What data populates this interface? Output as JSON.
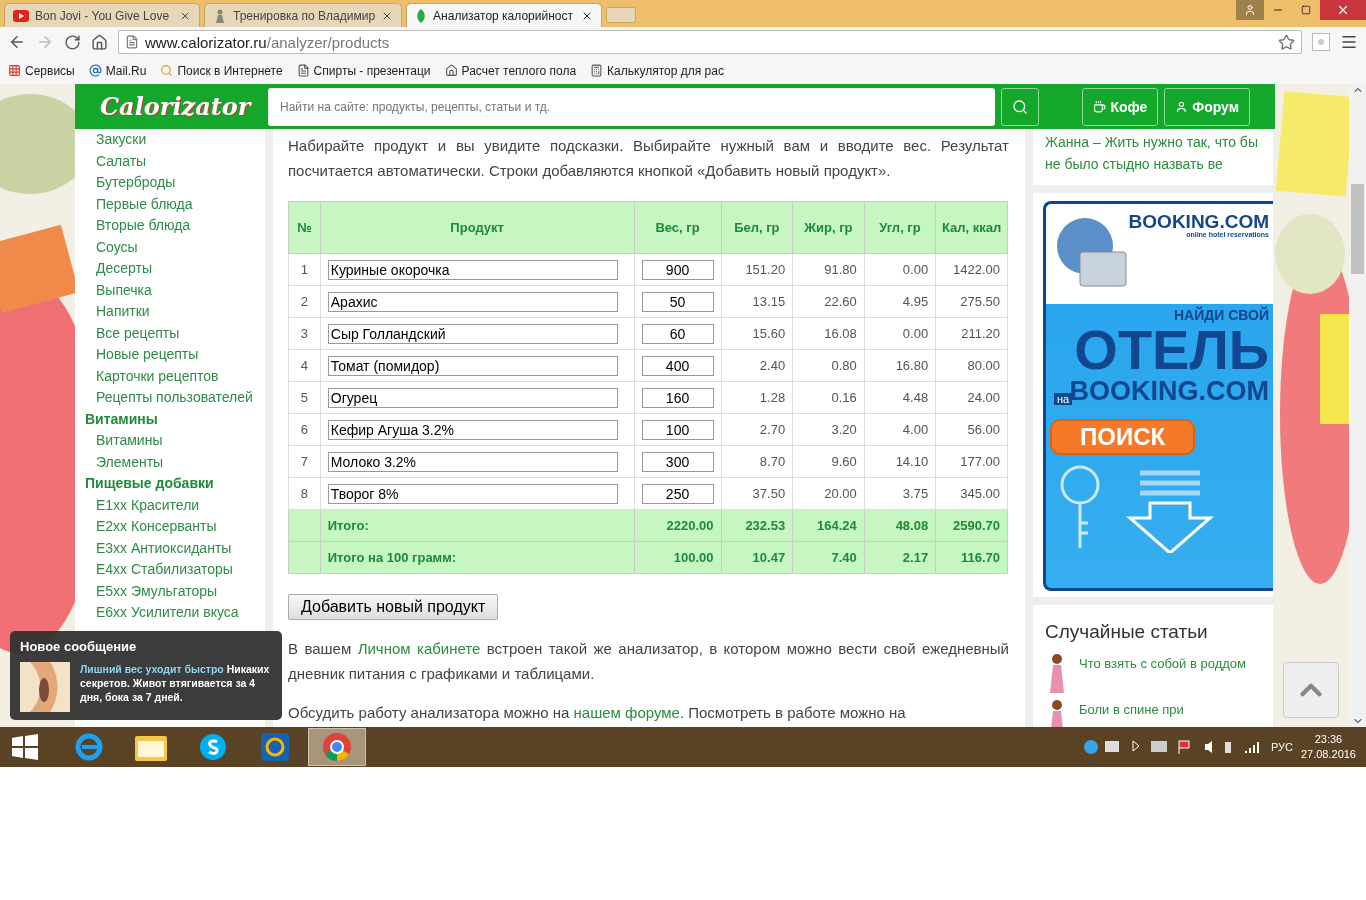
{
  "browser": {
    "tabs": [
      {
        "title": "Bon Jovi - You Give Love",
        "kind": "video",
        "selected": false
      },
      {
        "title": "Тренировка по Владимир",
        "kind": "figure",
        "selected": false
      },
      {
        "title": "Анализатор калорийност",
        "kind": "site",
        "selected": true
      }
    ],
    "address": {
      "host": "www.calorizator.ru",
      "path": "/analyzer/products"
    },
    "bookmarks": [
      {
        "label": "Сервисы",
        "kind": "apps"
      },
      {
        "label": "Mail.Ru",
        "kind": "mail"
      },
      {
        "label": "Поиск в Интернете",
        "kind": "search"
      },
      {
        "label": "Спирты - презентаци",
        "kind": "page"
      },
      {
        "label": "Расчет теплого пола",
        "kind": "house"
      },
      {
        "label": "Калькулятор для рас",
        "kind": "calc"
      }
    ]
  },
  "site": {
    "logo": "Calorizator",
    "search_placeholder": "Найти на сайте: продукты, рецепты, статьи и тд.",
    "nav": [
      {
        "label": "Кофе",
        "kind": "coffee"
      },
      {
        "label": "Форум",
        "kind": "user"
      }
    ]
  },
  "sidebar": [
    {
      "children": [
        "Закуски",
        "Салаты",
        "Бутерброды",
        "Первые блюда",
        "Вторые блюда",
        "Соусы",
        "Десерты",
        "Выпечка",
        "Напитки",
        "Все рецепты",
        "Новые рецепты",
        "Карточки рецептов",
        "Рецепты пользователей"
      ]
    },
    {
      "heading": "Витамины",
      "children": [
        "Витамины",
        "Элементы"
      ]
    },
    {
      "heading": "Пищевые добавки",
      "children": [
        "E1xx Красители",
        "E2xx Консерванты",
        "E3xx Антиоксиданты",
        "E4xx Стабилизаторы",
        "E5xx Эмульгаторы",
        "E6xx Усилители вкуса"
      ]
    }
  ],
  "intro": "Набирайте продукт и вы увидите подсказки. Выбирайте нужный вам и вводите вес. Результат посчитается автоматически. Строки добавляются кнопкой «Добавить новый продукт».",
  "table": {
    "columns": [
      "№",
      "Продукт",
      "Вес, гр",
      "Бел, гр",
      "Жир, гр",
      "Угл, гр",
      "Кал, ккал"
    ],
    "rows": [
      [
        "1",
        "Куриные окорочка",
        "900",
        "151.20",
        "91.80",
        "0.00",
        "1422.00"
      ],
      [
        "2",
        "Арахис",
        "50",
        "13.15",
        "22.60",
        "4.95",
        "275.50"
      ],
      [
        "3",
        "Сыр Голландский",
        "60",
        "15.60",
        "16.08",
        "0.00",
        "211.20"
      ],
      [
        "4",
        "Томат (помидор)",
        "400",
        "2.40",
        "0.80",
        "16.80",
        "80.00"
      ],
      [
        "5",
        "Огурец",
        "160",
        "1.28",
        "0.16",
        "4.48",
        "24.00"
      ],
      [
        "6",
        "Кефир Агуша 3.2%",
        "100",
        "2.70",
        "3.20",
        "4.00",
        "56.00"
      ],
      [
        "7",
        "Молоко 3.2%",
        "300",
        "8.70",
        "9.60",
        "14.10",
        "177.00"
      ],
      [
        "8",
        "Творог 8%",
        "250",
        "37.50",
        "20.00",
        "3.75",
        "345.00"
      ]
    ],
    "totals": [
      [
        "Итого:",
        "2220.00",
        "232.53",
        "164.24",
        "48.08",
        "2590.70"
      ],
      [
        "Итого на 100 грамм:",
        "100.00",
        "10.47",
        "7.40",
        "2.17",
        "116.70"
      ]
    ]
  },
  "add_button": "Добавить новый продукт",
  "paragraphs": [
    [
      {
        "text": "В вашем ",
        "kind": "text"
      },
      {
        "text": "Личном кабинете",
        "kind": "link"
      },
      {
        "text": " встроен такой же анализатор, в котором можно вести свой ежедневный дневник питания с графиками и таблицами.",
        "kind": "text"
      }
    ],
    [
      {
        "text": "Обсудить работу анализатора можно на ",
        "kind": "text"
      },
      {
        "text": "нашем форуме",
        "kind": "link"
      },
      {
        "text": ". Посмотреть в работе можно на",
        "kind": "text"
      }
    ]
  ],
  "quote": "Жанна – Жить нужно так, что бы не было стыдно назвать ве",
  "ad": {
    "brand": "BOOKING.COM",
    "tagline": "online hotel reservations",
    "line1": "НАЙДИ СВОЙ",
    "line2": "ОТЕЛЬ",
    "small": "на",
    "line3": "BOOKING.COM",
    "button": "ПОИСК"
  },
  "random_articles": {
    "title": "Случайные статьи",
    "items": [
      "Что взять с собой в роддом",
      "Боли в спине при"
    ]
  },
  "popup": {
    "title": "Новое сообщение",
    "link": "Лишний вес уходит быстро",
    "text": "Никаких секретов. Живот втягивается за 4 дня, бока за 7 дней."
  },
  "taskbar": {
    "apps": [
      {
        "kind": "ie",
        "selected": false
      },
      {
        "kind": "folder",
        "selected": false
      },
      {
        "kind": "skype",
        "selected": false
      },
      {
        "kind": "mail",
        "selected": false
      },
      {
        "kind": "chrome",
        "selected": true
      }
    ],
    "lang": "РУС",
    "time": "23:36",
    "date": "27.08.2016"
  }
}
